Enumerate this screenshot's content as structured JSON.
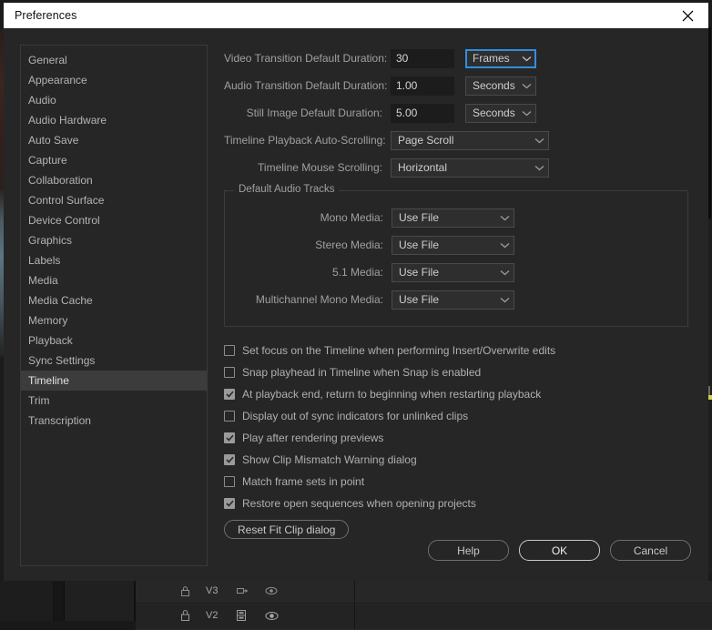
{
  "dialog": {
    "title": "Preferences",
    "close_icon": "close-icon"
  },
  "sidebar": {
    "items": [
      {
        "label": "General",
        "selected": false
      },
      {
        "label": "Appearance",
        "selected": false
      },
      {
        "label": "Audio",
        "selected": false
      },
      {
        "label": "Audio Hardware",
        "selected": false
      },
      {
        "label": "Auto Save",
        "selected": false
      },
      {
        "label": "Capture",
        "selected": false
      },
      {
        "label": "Collaboration",
        "selected": false
      },
      {
        "label": "Control Surface",
        "selected": false
      },
      {
        "label": "Device Control",
        "selected": false
      },
      {
        "label": "Graphics",
        "selected": false
      },
      {
        "label": "Labels",
        "selected": false
      },
      {
        "label": "Media",
        "selected": false
      },
      {
        "label": "Media Cache",
        "selected": false
      },
      {
        "label": "Memory",
        "selected": false
      },
      {
        "label": "Playback",
        "selected": false
      },
      {
        "label": "Sync Settings",
        "selected": false
      },
      {
        "label": "Timeline",
        "selected": true
      },
      {
        "label": "Trim",
        "selected": false
      },
      {
        "label": "Transcription",
        "selected": false
      }
    ]
  },
  "settings": {
    "duration_rows": [
      {
        "label": "Video Transition Default Duration:",
        "value": "30",
        "unit": "Frames",
        "unit_focused": true
      },
      {
        "label": "Audio Transition Default Duration:",
        "value": "1.00",
        "unit": "Seconds",
        "unit_focused": false
      },
      {
        "label": "Still Image Default Duration:",
        "value": "5.00",
        "unit": "Seconds",
        "unit_focused": false
      }
    ],
    "scroll_rows": [
      {
        "label": "Timeline Playback Auto-Scrolling:",
        "value": "Page Scroll"
      },
      {
        "label": "Timeline Mouse Scrolling:",
        "value": "Horizontal"
      }
    ]
  },
  "audio_tracks": {
    "legend": "Default Audio Tracks",
    "rows": [
      {
        "label": "Mono Media:",
        "value": "Use File"
      },
      {
        "label": "Stereo Media:",
        "value": "Use File"
      },
      {
        "label": "5.1 Media:",
        "value": "Use File"
      },
      {
        "label": "Multichannel Mono Media:",
        "value": "Use File"
      }
    ]
  },
  "checkboxes": [
    {
      "label": "Set focus on the Timeline when performing Insert/Overwrite edits",
      "checked": false
    },
    {
      "label": "Snap playhead in Timeline when Snap is enabled",
      "checked": false
    },
    {
      "label": "At playback end, return to beginning when restarting playback",
      "checked": true
    },
    {
      "label": "Display out of sync indicators for unlinked clips",
      "checked": false
    },
    {
      "label": "Play after rendering previews",
      "checked": true
    },
    {
      "label": "Show Clip Mismatch Warning dialog",
      "checked": true
    },
    {
      "label": "Match frame sets in point",
      "checked": false
    },
    {
      "label": "Restore open sequences when opening projects",
      "checked": true
    }
  ],
  "reset_button": {
    "label": "Reset Fit Clip dialog"
  },
  "footer": {
    "help_label": "Help",
    "ok_label": "OK",
    "cancel_label": "Cancel"
  },
  "background": {
    "tracks": [
      {
        "name": "V3",
        "lock_icon": "lock-icon",
        "sync_icon": "sync-lock-icon",
        "eye_icon": "eye-icon"
      },
      {
        "name": "V2",
        "lock_icon": "lock-icon",
        "sync_icon": "sync-lock-icon",
        "eye_icon": "eye-icon"
      }
    ]
  },
  "colors": {
    "dialog_bg": "#262626",
    "titlebar_bg": "#ffffff",
    "accent_focus": "#2f8fe0",
    "input_bg": "#1c1c1c",
    "select_bg": "#2e2e2e",
    "clip_yellow": "#d2d14a"
  }
}
